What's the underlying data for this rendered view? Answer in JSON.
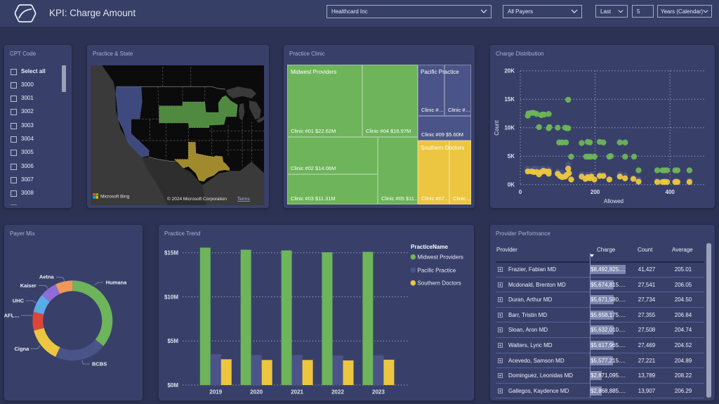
{
  "header": {
    "title": "KPI: Charge Amount",
    "filters": {
      "company": "Healthcard Inc",
      "payer": "All Payers",
      "period_mode": "Last",
      "period_count": "5",
      "period_unit": "Years (Calendar)"
    }
  },
  "cpt_slicer": {
    "title": "CPT Code",
    "items": [
      {
        "label": "Select all",
        "checked": false
      },
      {
        "label": "3000",
        "checked": false
      },
      {
        "label": "3001",
        "checked": false
      },
      {
        "label": "3002",
        "checked": false
      },
      {
        "label": "3003",
        "checked": false
      },
      {
        "label": "3004",
        "checked": false
      },
      {
        "label": "3005",
        "checked": false
      },
      {
        "label": "3006",
        "checked": false
      },
      {
        "label": "3007",
        "checked": false
      },
      {
        "label": "3008",
        "checked": false
      }
    ]
  },
  "practice_state_map": {
    "title": "Practice & State",
    "bing_label": "Microsoft Bing",
    "copyright": "© 2024 Microsoft Corporation",
    "terms_link": "Terms"
  },
  "colors": {
    "midwest": "#6db45a",
    "pacific": "#4a5488",
    "southern": "#ecc640",
    "map_midwest": "#4f8a40",
    "map_pacific": "#3e4a7e",
    "map_southern": "#a08a2c",
    "page_background": "#2c3254",
    "header_background": "#363f66",
    "card_background": "#38406a"
  },
  "practice_clinic": {
    "title": "Practice Clinic",
    "groups": [
      {
        "name": "Midwest Providers",
        "tiles": [
          "Clinic #01 $22.62M",
          "Clinic #04 $16.97M",
          "Clinic #02 $14.06M",
          "Clinic #03 $11.31M",
          "Clinic #05 $11…"
        ]
      },
      {
        "name": "Pacific Practice",
        "tiles": [
          "Clinic #…",
          "Clinic #…",
          "Clinic #09 $5.60M"
        ]
      },
      {
        "name": "Southern Doctors",
        "tiles": [
          "Clinic #07…",
          "Clinic…"
        ]
      }
    ]
  },
  "chart_data": [
    {
      "type": "scatter",
      "title": "Charge Distribution",
      "xlabel": "Allowed",
      "ylabel": "Count",
      "xlim": [
        0,
        500
      ],
      "ylim": [
        0,
        20000
      ],
      "grid": true,
      "xticks": [
        {
          "value": 0,
          "label": "0"
        },
        {
          "value": 200,
          "label": "200"
        },
        {
          "value": 400,
          "label": "400"
        }
      ],
      "yticks": [
        {
          "value": 0,
          "label": "0K"
        },
        {
          "value": 5000,
          "label": "5K"
        },
        {
          "value": 10000,
          "label": "10K"
        },
        {
          "value": 15000,
          "label": "15K"
        },
        {
          "value": 20000,
          "label": "20K"
        }
      ],
      "series": [
        {
          "name": "Midwest Providers",
          "color": "#6db45a",
          "points": [
            [
              20,
              12100
            ],
            [
              22,
              12500
            ],
            [
              30,
              12600
            ],
            [
              36,
              12600
            ],
            [
              44,
              12400
            ],
            [
              56,
              12200
            ],
            [
              60,
              12300
            ],
            [
              64,
              12300
            ],
            [
              76,
              12400
            ],
            [
              128,
              14900
            ],
            [
              50,
              10100
            ],
            [
              76,
              9900
            ],
            [
              78,
              10100
            ],
            [
              100,
              10000
            ],
            [
              120,
              10000
            ],
            [
              124,
              9900
            ],
            [
              128,
              9900
            ],
            [
              104,
              7400
            ],
            [
              112,
              7400
            ],
            [
              122,
              7400
            ],
            [
              164,
              7300
            ],
            [
              180,
              7500
            ],
            [
              186,
              7400
            ],
            [
              212,
              7500
            ],
            [
              222,
              7400
            ],
            [
              266,
              7400
            ],
            [
              280,
              7400
            ],
            [
              136,
              4900
            ],
            [
              176,
              4900
            ],
            [
              182,
              4900
            ],
            [
              188,
              4900
            ],
            [
              198,
              4900
            ],
            [
              238,
              4900
            ],
            [
              242,
              5000
            ],
            [
              280,
              4900
            ],
            [
              304,
              4900
            ],
            [
              316,
              2500
            ],
            [
              366,
              2500
            ],
            [
              380,
              2500
            ],
            [
              386,
              2500
            ],
            [
              392,
              2500
            ],
            [
              414,
              2500
            ],
            [
              420,
              2500
            ],
            [
              452,
              2500
            ]
          ]
        },
        {
          "name": "Pacific Practice",
          "color": "#4a5488",
          "points": [
            [
              20,
              2800
            ],
            [
              36,
              2800
            ],
            [
              44,
              2800
            ],
            [
              60,
              2800
            ],
            [
              76,
              2700
            ],
            [
              100,
              2300
            ],
            [
              112,
              2100
            ],
            [
              128,
              3500
            ],
            [
              164,
              1800
            ],
            [
              180,
              1700
            ],
            [
              190,
              1800
            ],
            [
              214,
              1800
            ],
            [
              222,
              1700
            ],
            [
              266,
              1800
            ],
            [
              280,
              1600
            ],
            [
              316,
              900
            ],
            [
              366,
              700
            ],
            [
              386,
              700
            ],
            [
              416,
              700
            ],
            [
              452,
              700
            ]
          ]
        },
        {
          "name": "Southern Doctors",
          "color": "#ecc640",
          "points": [
            [
              20,
              2300
            ],
            [
              30,
              2300
            ],
            [
              36,
              2200
            ],
            [
              44,
              2200
            ],
            [
              50,
              1800
            ],
            [
              56,
              2200
            ],
            [
              62,
              2400
            ],
            [
              68,
              2300
            ],
            [
              76,
              1900
            ],
            [
              76,
              2300
            ],
            [
              100,
              1900
            ],
            [
              106,
              1500
            ],
            [
              112,
              1300
            ],
            [
              120,
              1400
            ],
            [
              124,
              1700
            ],
            [
              128,
              2800
            ],
            [
              130,
              2000
            ],
            [
              136,
              900
            ],
            [
              164,
              1400
            ],
            [
              174,
              1000
            ],
            [
              180,
              1300
            ],
            [
              186,
              1100
            ],
            [
              190,
              1400
            ],
            [
              198,
              900
            ],
            [
              212,
              1500
            ],
            [
              222,
              1500
            ],
            [
              238,
              900
            ],
            [
              266,
              1400
            ],
            [
              280,
              1100
            ],
            [
              302,
              1000
            ],
            [
              316,
              500
            ],
            [
              366,
              450
            ],
            [
              380,
              450
            ],
            [
              386,
              450
            ],
            [
              392,
              450
            ],
            [
              414,
              450
            ],
            [
              420,
              450
            ],
            [
              452,
              450
            ]
          ]
        }
      ]
    },
    {
      "type": "pie",
      "title": "Payer Mix",
      "donut": true,
      "categories": [
        "Humana",
        "BCBS",
        "Cigna",
        "AFL…",
        "UHC",
        "Kaiser",
        "Aetna"
      ],
      "values": [
        36,
        21,
        14,
        7.5,
        7.5,
        7,
        7
      ],
      "unit": "percent of charge (estimated)",
      "colors": [
        "#6db45a",
        "#4a5488",
        "#ecc640",
        "#d9473b",
        "#5aace6",
        "#8f6cd6",
        "#f0975a"
      ]
    },
    {
      "type": "bar",
      "title": "Practice Trend",
      "xlabel": "",
      "ylabel": "",
      "categories": [
        "2019",
        "2020",
        "2021",
        "2022",
        "2023"
      ],
      "ylim": [
        0,
        15
      ],
      "unit": "$M",
      "yticks": [
        {
          "value": 0,
          "label": "$0M"
        },
        {
          "value": 5,
          "label": "$5M"
        },
        {
          "value": 10,
          "label": "$10M"
        },
        {
          "value": 15,
          "label": "$15M"
        }
      ],
      "grid": true,
      "legend": {
        "title": "PracticeName",
        "position": "top-right"
      },
      "series": [
        {
          "name": "Midwest Providers",
          "color": "#6db45a",
          "values": [
            15.58,
            15.34,
            15.26,
            15.05,
            15.1
          ]
        },
        {
          "name": "Pacific Practice",
          "color": "#4a5488",
          "values": [
            3.5,
            3.4,
            3.4,
            3.35,
            3.37
          ]
        },
        {
          "name": "Southern Doctors",
          "color": "#ecc640",
          "values": [
            2.92,
            2.84,
            2.84,
            2.79,
            2.87
          ]
        }
      ]
    }
  ],
  "provider_performance": {
    "title": "Provider Performance",
    "columns": [
      "Provider",
      "Charge",
      "Count",
      "Average"
    ],
    "sort": {
      "column": "Charge",
      "direction": "descending"
    },
    "rows": [
      {
        "name": "Frazier, Fabian MD",
        "charge": "$8,492,825.…",
        "charge_value": 8492825,
        "count": "41,427",
        "average": "205.01"
      },
      {
        "name": "Mcdonald, Brenton MD",
        "charge": "$5,674,815.…",
        "charge_value": 5674815,
        "count": "27,541",
        "average": "206.05"
      },
      {
        "name": "Duran, Arthur MD",
        "charge": "$5,671,580.…",
        "charge_value": 5671580,
        "count": "27,734",
        "average": "204.50"
      },
      {
        "name": "Barr, Tristin MD",
        "charge": "$5,658,175.…",
        "charge_value": 5658175,
        "count": "27,355",
        "average": "206.84"
      },
      {
        "name": "Sloan, Aron MD",
        "charge": "$5,632,010.…",
        "charge_value": 5632010,
        "count": "27,508",
        "average": "204.74"
      },
      {
        "name": "Walters, Lyric MD",
        "charge": "$5,617,965.…",
        "charge_value": 5617965,
        "count": "27,469",
        "average": "204.52"
      },
      {
        "name": "Acevedo, Samson MD",
        "charge": "$5,577,215.…",
        "charge_value": 5577215,
        "count": "27,221",
        "average": "204.89"
      },
      {
        "name": "Dominguez, Leonidas MD",
        "charge": "$2,871,095.…",
        "charge_value": 2871095,
        "count": "13,789",
        "average": "208.22"
      },
      {
        "name": "Gallegos, Kaydence MD",
        "charge": "$2,868,885.…",
        "charge_value": 2868885,
        "count": "13,907",
        "average": "206.29"
      }
    ]
  }
}
